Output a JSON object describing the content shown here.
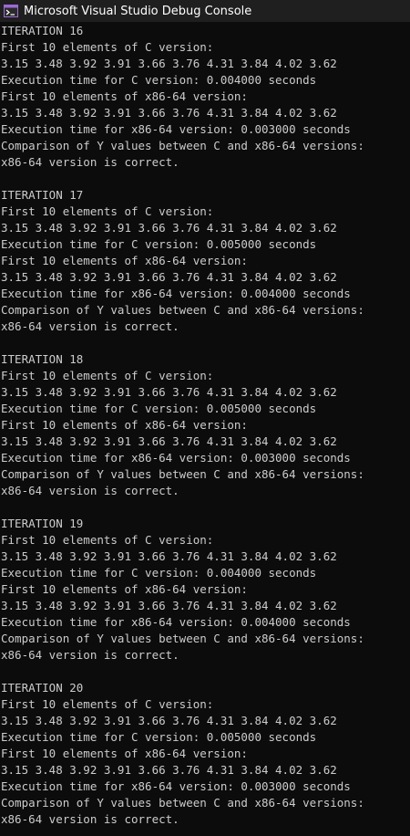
{
  "window": {
    "title": "Microsoft Visual Studio Debug Console",
    "icon": "vs-debug-console-icon"
  },
  "colors": {
    "background": "#0c0c0c",
    "text": "#cccccc",
    "titlebar": "#1f1f1f",
    "icon_accent": "#9b6ad6"
  },
  "console": {
    "lines": [
      "ITERATION 16",
      "First 10 elements of C version:",
      "3.15 3.48 3.92 3.91 3.66 3.76 4.31 3.84 4.02 3.62",
      "Execution time for C version: 0.004000 seconds",
      "First 10 elements of x86-64 version:",
      "3.15 3.48 3.92 3.91 3.66 3.76 4.31 3.84 4.02 3.62",
      "Execution time for x86-64 version: 0.003000 seconds",
      "Comparison of Y values between C and x86-64 versions:",
      "x86-64 version is correct.",
      "",
      "ITERATION 17",
      "First 10 elements of C version:",
      "3.15 3.48 3.92 3.91 3.66 3.76 4.31 3.84 4.02 3.62",
      "Execution time for C version: 0.005000 seconds",
      "First 10 elements of x86-64 version:",
      "3.15 3.48 3.92 3.91 3.66 3.76 4.31 3.84 4.02 3.62",
      "Execution time for x86-64 version: 0.004000 seconds",
      "Comparison of Y values between C and x86-64 versions:",
      "x86-64 version is correct.",
      "",
      "ITERATION 18",
      "First 10 elements of C version:",
      "3.15 3.48 3.92 3.91 3.66 3.76 4.31 3.84 4.02 3.62",
      "Execution time for C version: 0.005000 seconds",
      "First 10 elements of x86-64 version:",
      "3.15 3.48 3.92 3.91 3.66 3.76 4.31 3.84 4.02 3.62",
      "Execution time for x86-64 version: 0.003000 seconds",
      "Comparison of Y values between C and x86-64 versions:",
      "x86-64 version is correct.",
      "",
      "ITERATION 19",
      "First 10 elements of C version:",
      "3.15 3.48 3.92 3.91 3.66 3.76 4.31 3.84 4.02 3.62",
      "Execution time for C version: 0.004000 seconds",
      "First 10 elements of x86-64 version:",
      "3.15 3.48 3.92 3.91 3.66 3.76 4.31 3.84 4.02 3.62",
      "Execution time for x86-64 version: 0.004000 seconds",
      "Comparison of Y values between C and x86-64 versions:",
      "x86-64 version is correct.",
      "",
      "ITERATION 20",
      "First 10 elements of C version:",
      "3.15 3.48 3.92 3.91 3.66 3.76 4.31 3.84 4.02 3.62",
      "Execution time for C version: 0.005000 seconds",
      "First 10 elements of x86-64 version:",
      "3.15 3.48 3.92 3.91 3.66 3.76 4.31 3.84 4.02 3.62",
      "Execution time for x86-64 version: 0.003000 seconds",
      "Comparison of Y values between C and x86-64 versions:",
      "x86-64 version is correct."
    ]
  }
}
